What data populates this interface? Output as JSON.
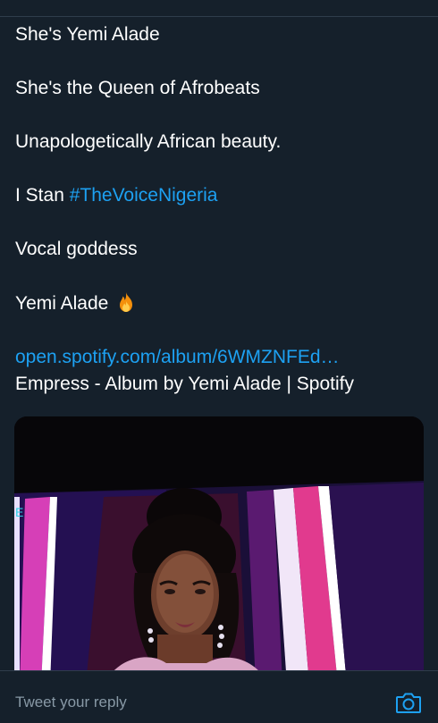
{
  "tweet": {
    "lines": [
      "She's Yemi Alade",
      "She's the Queen of Afrobeats",
      "Unapologetically African beauty.",
      "I Stan ",
      "Vocal goddess",
      "Yemi Alade "
    ],
    "hashtag": "#TheVoiceNigeria",
    "emoji_icon": "fire-icon"
  },
  "link_card": {
    "url": "open.spotify.com/album/6WMZNFEd…",
    "title": "Empress - Album by Yemi Alade | Spotify"
  },
  "media": {
    "tv_letter": "E"
  },
  "reply": {
    "placeholder": "Tweet your reply",
    "camera_icon": "camera-icon"
  },
  "colors": {
    "background": "#15202b",
    "accent": "#1da1f2",
    "muted": "#8899a6"
  }
}
